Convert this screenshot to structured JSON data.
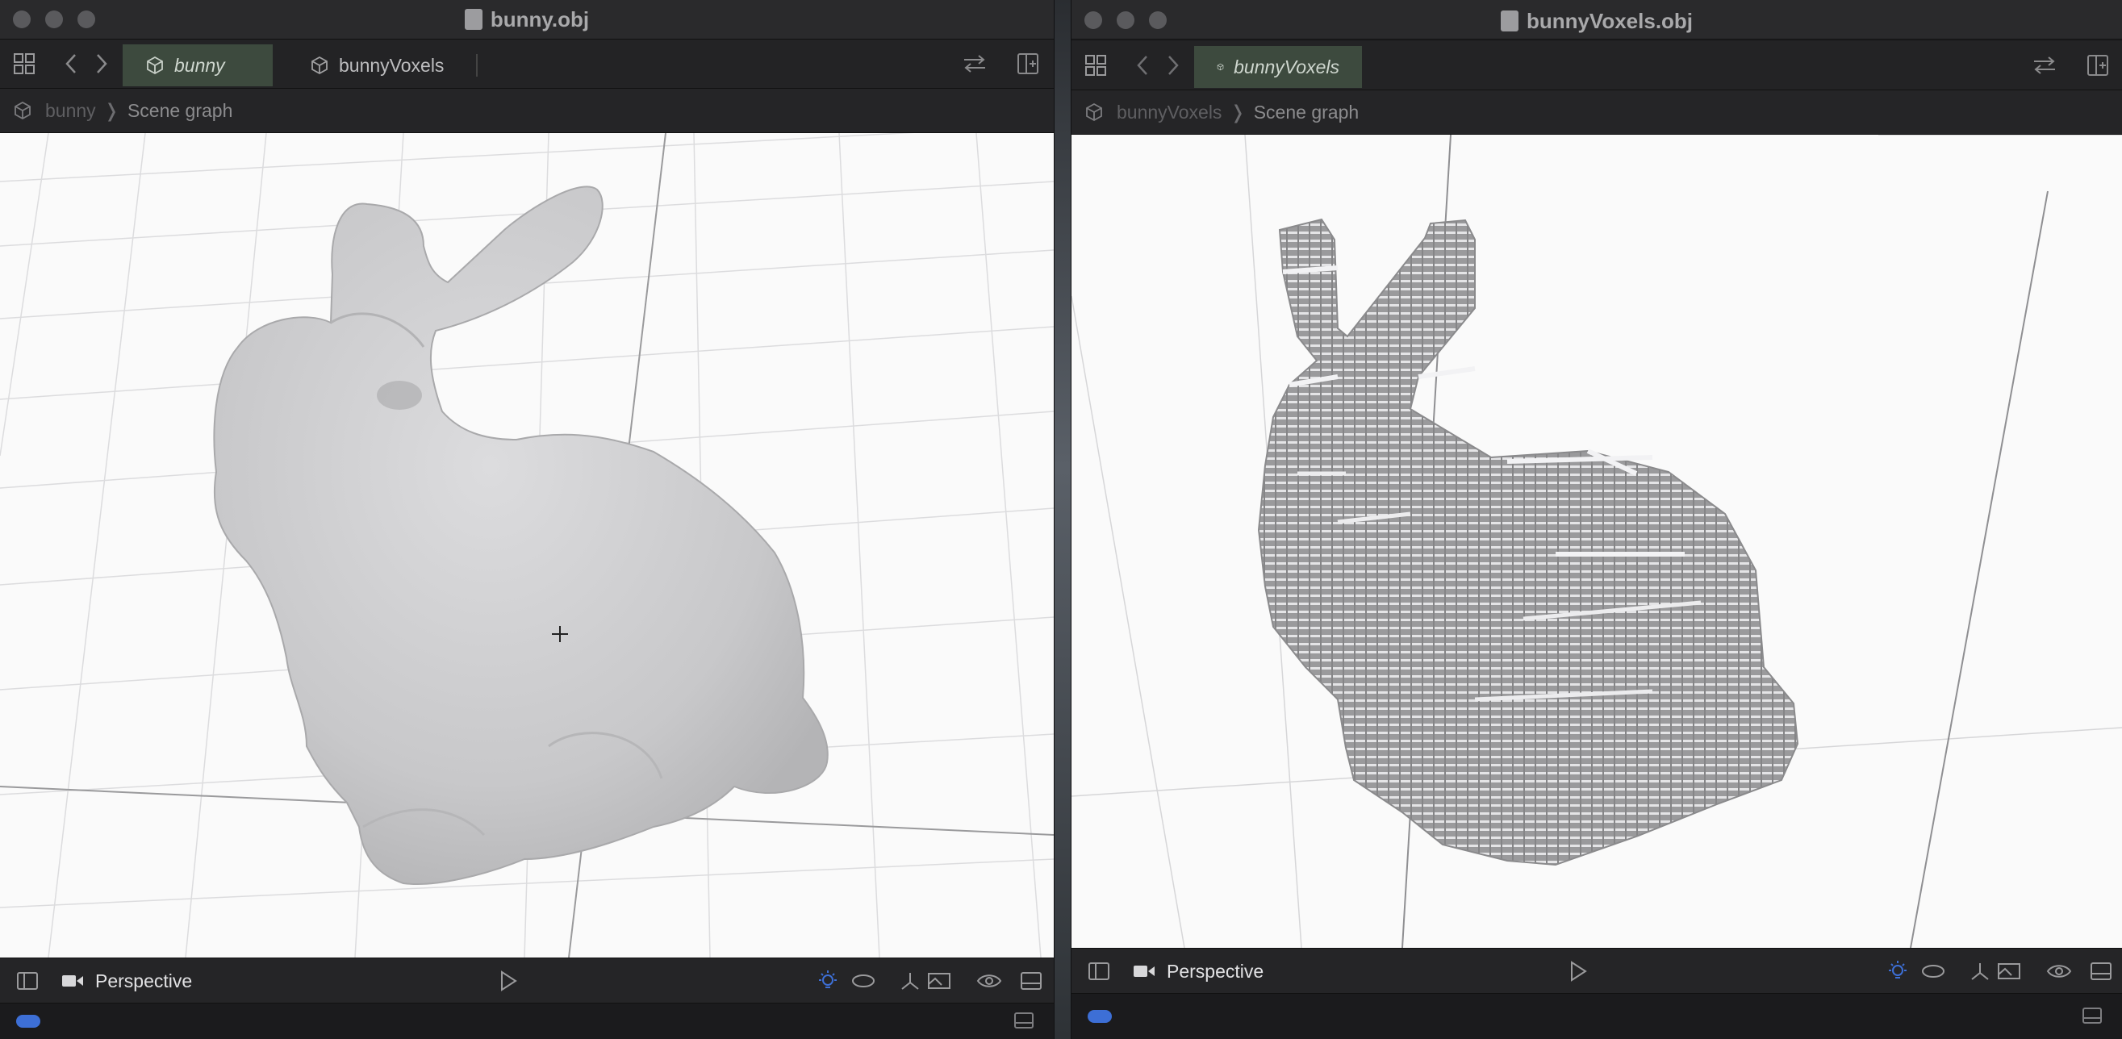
{
  "left_window": {
    "title": "bunny.obj",
    "tabs": [
      {
        "label": "bunny",
        "active": true
      },
      {
        "label": "bunnyVoxels",
        "active": false
      }
    ],
    "breadcrumb": {
      "root": "bunny",
      "separator": "❭",
      "current": "Scene graph"
    },
    "camera_label": "Perspective",
    "model": "smooth-mesh"
  },
  "right_window": {
    "title": "bunnyVoxels.obj",
    "tabs": [
      {
        "label": "bunnyVoxels",
        "active": true
      }
    ],
    "breadcrumb": {
      "root": "bunnyVoxels",
      "separator": "❭",
      "current": "Scene graph"
    },
    "camera_label": "Perspective",
    "model": "voxel-mesh"
  },
  "colors": {
    "chrome": "#1e1e20",
    "active_tab": "#3d4a3e",
    "accent_blue": "#3d6fd6",
    "viewport_bg": "#fafafa"
  },
  "icons": [
    "grid-icon",
    "back-icon",
    "forward-icon",
    "cube-icon",
    "swap-icon",
    "add-editor-icon",
    "sidebar-icon",
    "camera-icon",
    "play-icon",
    "light-icon",
    "orbit-icon",
    "axes-icon",
    "frame-icon",
    "eye-icon",
    "inspector-icon"
  ]
}
